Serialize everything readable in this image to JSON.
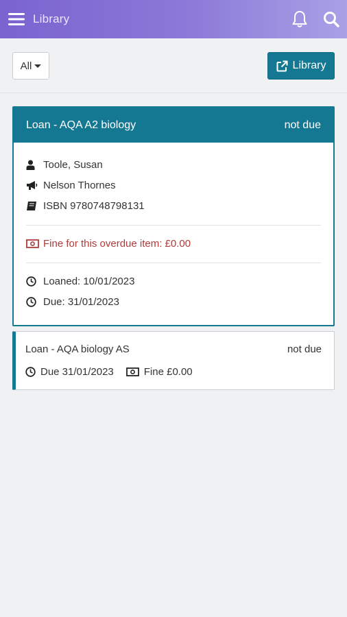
{
  "appbar": {
    "title": "Library",
    "icons": {
      "menu": "hamburger-menu-icon",
      "notifications": "bell-icon",
      "search": "search-icon"
    },
    "colors": {
      "gradient_start": "#7a63cf",
      "gradient_end": "#a9a0e6"
    }
  },
  "toolbar": {
    "filter_value": "All",
    "library_button_label": "Library",
    "library_button_icon": "external-link-icon"
  },
  "theme": {
    "accent": "#157893",
    "fine_color": "#b03a3a"
  },
  "loans": [
    {
      "title": "Loan - AQA A2 biology",
      "status": "not due",
      "author": "Toole, Susan",
      "publisher": "Nelson Thornes",
      "isbn": "ISBN 9780748798131",
      "fine_text": "Fine for this overdue item: £0.00",
      "loaned": "Loaned: 10/01/2023",
      "due": "Due: 31/01/2023"
    },
    {
      "title": "Loan - AQA biology AS",
      "status": "not due",
      "due_short": "Due 31/01/2023",
      "fine_short": "Fine £0.00"
    }
  ]
}
